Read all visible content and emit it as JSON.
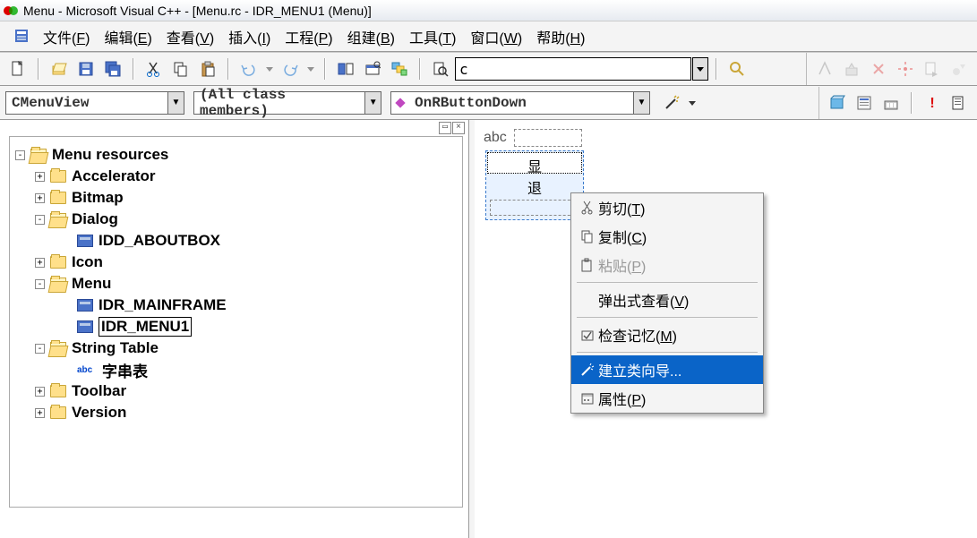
{
  "titlebar": {
    "text": "Menu - Microsoft Visual C++ - [Menu.rc - IDR_MENU1 (Menu)]"
  },
  "menubar": {
    "items": [
      {
        "label": "文件",
        "accel": "F"
      },
      {
        "label": "编辑",
        "accel": "E"
      },
      {
        "label": "查看",
        "accel": "V"
      },
      {
        "label": "插入",
        "accel": "I"
      },
      {
        "label": "工程",
        "accel": "P"
      },
      {
        "label": "组建",
        "accel": "B"
      },
      {
        "label": "工具",
        "accel": "T"
      },
      {
        "label": "窗口",
        "accel": "W"
      },
      {
        "label": "帮助",
        "accel": "H"
      }
    ]
  },
  "toolbar2": {
    "find_value": "c"
  },
  "combos": {
    "class_combo": "CMenuView",
    "filter_combo": "(All class members)",
    "func_combo": "OnRButtonDown"
  },
  "tree": {
    "root": "Menu resources",
    "items": [
      {
        "level": 1,
        "exp": "+",
        "icon": "folder-closed",
        "label": "Accelerator"
      },
      {
        "level": 1,
        "exp": "+",
        "icon": "folder-closed",
        "label": "Bitmap"
      },
      {
        "level": 1,
        "exp": "-",
        "icon": "folder-open",
        "label": "Dialog"
      },
      {
        "level": 2,
        "exp": "",
        "icon": "rc",
        "label": "IDD_ABOUTBOX"
      },
      {
        "level": 1,
        "exp": "+",
        "icon": "folder-closed",
        "label": "Icon"
      },
      {
        "level": 1,
        "exp": "-",
        "icon": "folder-open",
        "label": "Menu"
      },
      {
        "level": 2,
        "exp": "",
        "icon": "rc",
        "label": "IDR_MAINFRAME"
      },
      {
        "level": 2,
        "exp": "",
        "icon": "rc",
        "label": "IDR_MENU1",
        "selected": true
      },
      {
        "level": 1,
        "exp": "-",
        "icon": "folder-open",
        "label": "String Table"
      },
      {
        "level": 2,
        "exp": "",
        "icon": "abc",
        "label": "字串表"
      },
      {
        "level": 1,
        "exp": "+",
        "icon": "folder-closed",
        "label": "Toolbar"
      },
      {
        "level": 1,
        "exp": "+",
        "icon": "folder-closed",
        "label": "Version"
      }
    ]
  },
  "menu_designer": {
    "top_label": "abc",
    "sub_items": [
      "显",
      "退"
    ]
  },
  "context_menu": {
    "items": [
      {
        "icon": "cut",
        "label": "剪切",
        "accel": "T",
        "enabled": true
      },
      {
        "icon": "copy",
        "label": "复制",
        "accel": "C",
        "enabled": true
      },
      {
        "icon": "paste",
        "label": "粘贴",
        "accel": "P",
        "enabled": false
      },
      {
        "sep": true
      },
      {
        "icon": "",
        "label": "弹出式查看",
        "accel": "V",
        "enabled": true
      },
      {
        "sep": true
      },
      {
        "icon": "check",
        "label": "检查记忆",
        "accel": "M",
        "enabled": true
      },
      {
        "sep": true
      },
      {
        "icon": "wizard",
        "label": "建立类向导...",
        "accel": "",
        "enabled": true,
        "selected": true
      },
      {
        "icon": "props",
        "label": "属性",
        "accel": "P",
        "enabled": true
      }
    ]
  }
}
